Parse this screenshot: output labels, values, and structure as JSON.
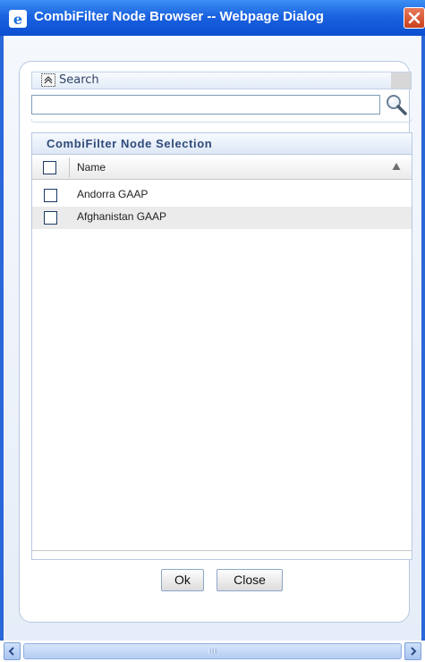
{
  "window": {
    "title": "CombiFilter Node Browser -- Webpage Dialog",
    "app_icon": "ie-icon",
    "close_icon": "close-icon"
  },
  "search": {
    "section_label": "Search",
    "toggle_icon": "collapse-icon",
    "input_value": "",
    "search_icon": "magnifier-icon"
  },
  "grid": {
    "title": "CombiFilter Node Selection",
    "column_name": "Name",
    "sort_icon": "sort-ascending-icon",
    "rows": [
      {
        "label": "Andorra GAAP",
        "checked": false
      },
      {
        "label": "Afghanistan GAAP",
        "checked": false
      }
    ]
  },
  "buttons": {
    "ok": "Ok",
    "close": "Close"
  },
  "scrollbar": {
    "left_icon": "scroll-left-icon",
    "right_icon": "scroll-right-icon"
  },
  "colors": {
    "titlebar": "#1a62e0",
    "panel_border": "#b8c9e2",
    "row_alt": "#ebebeb"
  }
}
